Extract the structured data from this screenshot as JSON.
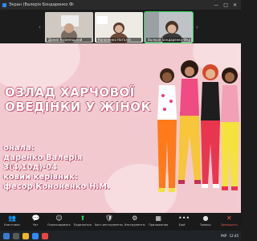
{
  "window": {
    "title": "Экран (Валерія Бондаренко Фі",
    "controls": [
      "—",
      "□",
      "✕"
    ]
  },
  "participants": [
    {
      "name": "Данил Козинецький",
      "active": false
    },
    {
      "name": "Кононенко Наталія",
      "active": false
    },
    {
      "name": "Валерія Бондаренко Фед",
      "active": true
    }
  ],
  "slide": {
    "title_line1": "ОЗЛАД ХАРЧОВОЇ",
    "title_line2": "ОВЕДІНКИ У ЖІНОК",
    "author_label": "онала:",
    "author_name": "даренко Валерія",
    "group": "3(4,10д)-04",
    "advisor_label": "ковий керівник:",
    "advisor_name": "фесор Кононенко Н.М."
  },
  "toolbar": [
    {
      "label": "Участники",
      "icon": "participants-icon",
      "glyph": "👥",
      "count": "15"
    },
    {
      "label": "Чат",
      "icon": "chat-icon",
      "glyph": "💬"
    },
    {
      "label": "Отреагировать",
      "icon": "react-icon",
      "glyph": "☺"
    },
    {
      "label": "Поделиться",
      "icon": "share-icon",
      "glyph": "⬆",
      "green": true
    },
    {
      "label": "Хост-инструменты",
      "icon": "host-tools-icon",
      "glyph": "🛡"
    },
    {
      "label": "Инструменты",
      "icon": "tools-icon",
      "glyph": "⚙"
    },
    {
      "label": "Приложения",
      "icon": "apps-icon",
      "glyph": "▦"
    },
    {
      "label": "Ещё",
      "icon": "more-icon",
      "glyph": "•••"
    },
    {
      "label": "Запись",
      "icon": "record-icon",
      "glyph": "●"
    },
    {
      "label": "Завершить",
      "icon": "end-icon",
      "glyph": "✕",
      "red": true
    }
  ],
  "colors": {
    "slide_bg": "#f2c9cf",
    "accent_green": "#2fd15e",
    "end_red": "#e85a4f"
  },
  "taskbar": {
    "lang": "УКР",
    "time": "12:45"
  }
}
